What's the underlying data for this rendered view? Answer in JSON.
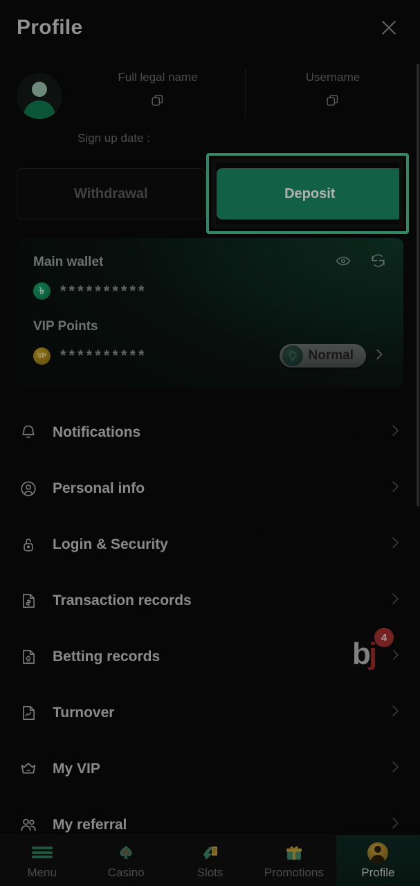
{
  "header": {
    "title": "Profile",
    "close_icon": "close-icon"
  },
  "profile": {
    "avatar_icon": "avatar-placeholder-icon",
    "fields": [
      {
        "label": "Full legal name",
        "value": "",
        "copy_icon": "copy-icon"
      },
      {
        "label": "Username",
        "value": "",
        "copy_icon": "copy-icon"
      }
    ],
    "signup_date_label": "Sign up date :",
    "signup_date_value": ""
  },
  "actions": {
    "withdrawal_label": "Withdrawal",
    "deposit_label": "Deposit",
    "deposit_highlighted": true,
    "highlight_color": "#45c491",
    "deposit_color": "#1b8a64"
  },
  "wallet": {
    "main_wallet_label": "Main wallet",
    "main_wallet_amount": "**********",
    "main_wallet_currency_icon": "taka-coin-icon",
    "main_wallet_currency_symbol": "৳",
    "eye_icon": "eye-icon",
    "refresh_icon": "refresh-icon",
    "vip_points_label": "VIP Points",
    "vip_points_amount": "**********",
    "vip_points_icon": "vip-coin-icon",
    "vip_points_symbol": "VP",
    "rank_label": "Normal",
    "rank_gem_icon": "gem-icon",
    "rank_arrow_icon": "chevron-right-icon"
  },
  "menu": {
    "items": [
      {
        "label": "Notifications",
        "icon": "bell-icon",
        "arrow": "chevron-right-icon"
      },
      {
        "label": "Personal info",
        "icon": "user-circle-icon",
        "arrow": "chevron-right-icon"
      },
      {
        "label": "Login & Security",
        "icon": "lock-icon",
        "arrow": "chevron-right-icon"
      },
      {
        "label": "Transaction records",
        "icon": "document-dollar-icon",
        "arrow": "chevron-right-icon"
      },
      {
        "label": "Betting records",
        "icon": "document-bet-icon",
        "arrow": "chevron-right-icon"
      },
      {
        "label": "Turnover",
        "icon": "document-chart-icon",
        "arrow": "chevron-right-icon"
      },
      {
        "label": "My VIP",
        "icon": "crown-icon",
        "arrow": "chevron-right-icon"
      },
      {
        "label": "My referral",
        "icon": "users-icon",
        "arrow": "chevron-right-icon"
      }
    ]
  },
  "chat_widget": {
    "logo_first": "b",
    "logo_second": "j",
    "badge_count": "4",
    "badge_color": "#a83232"
  },
  "bottom_nav": {
    "items": [
      {
        "label": "Menu",
        "icon": "hamburger-icon",
        "active": false
      },
      {
        "label": "Casino",
        "icon": "spade-icon",
        "active": false
      },
      {
        "label": "Slots",
        "icon": "slots-icon",
        "active": false
      },
      {
        "label": "Promotions",
        "icon": "gift-icon",
        "active": false
      },
      {
        "label": "Profile",
        "icon": "avatar-icon",
        "active": true
      }
    ]
  }
}
